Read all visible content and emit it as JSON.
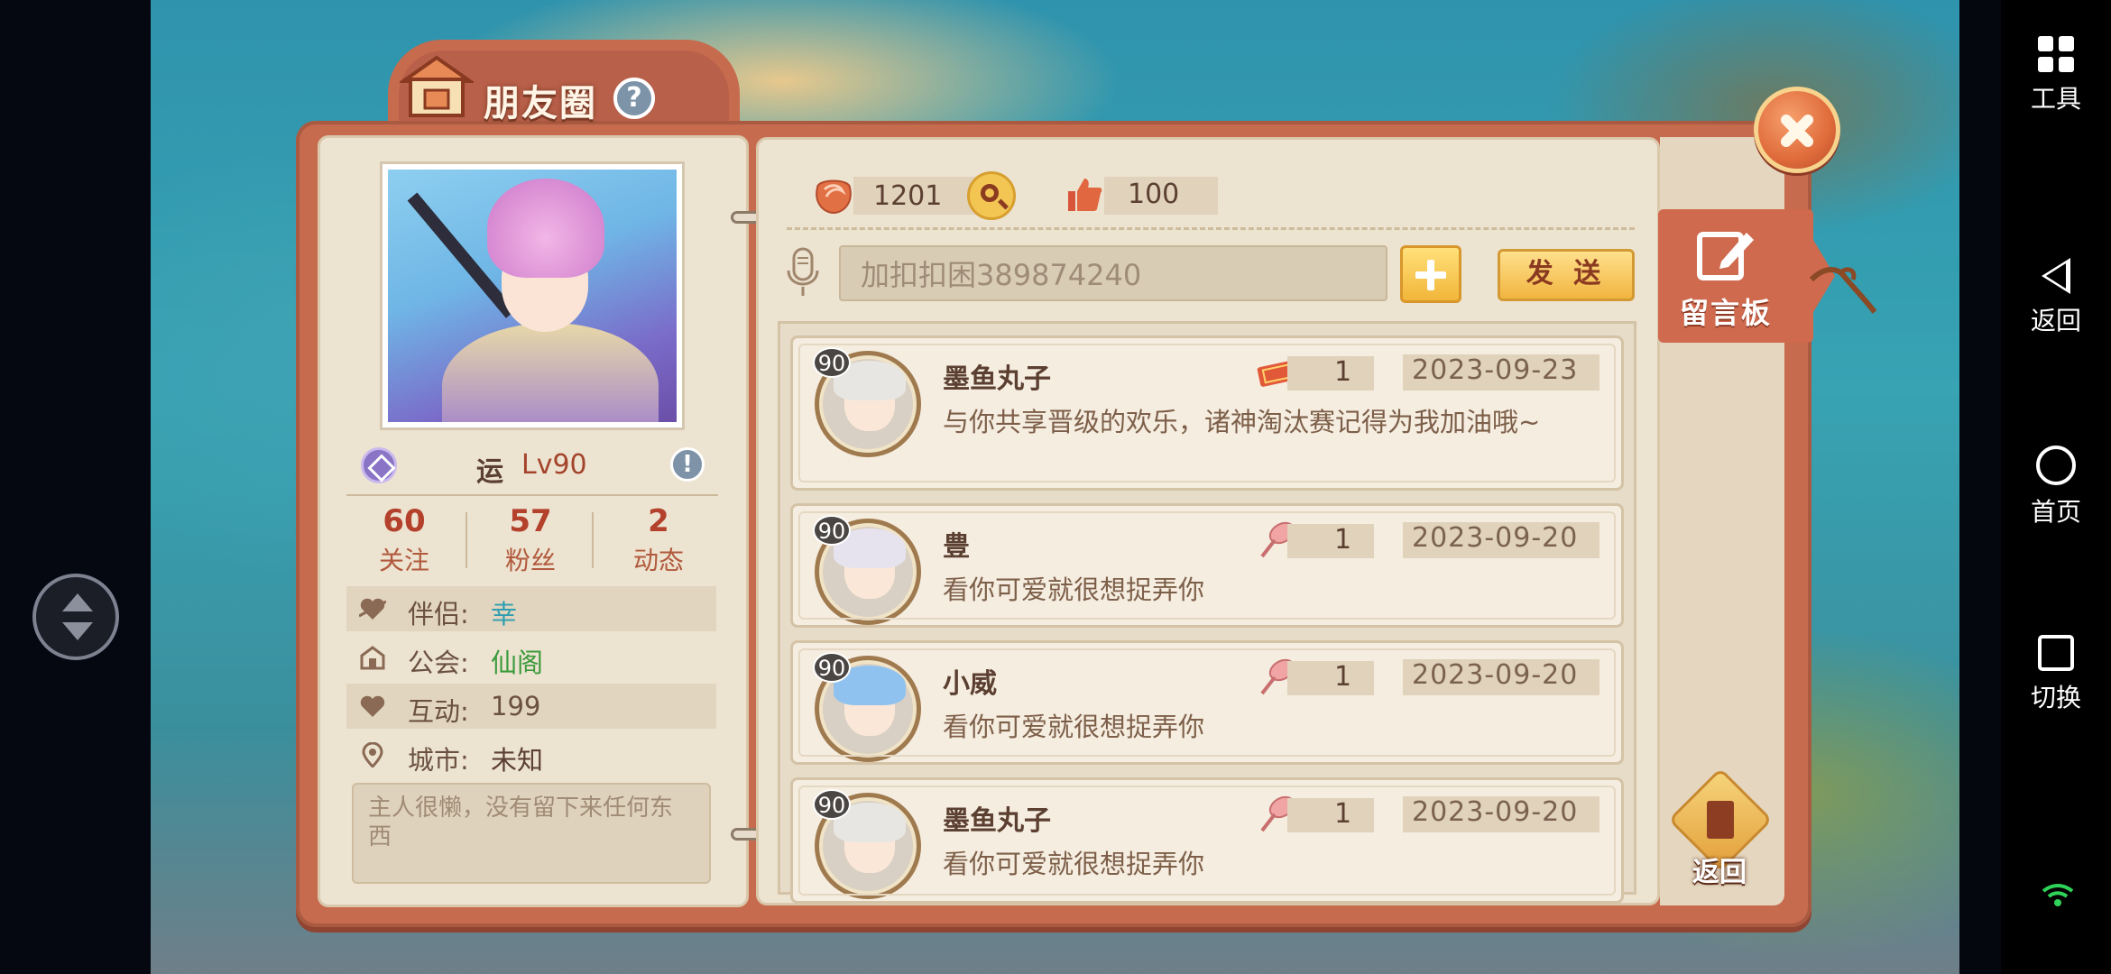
{
  "app": {
    "title": "朋友圈"
  },
  "profile": {
    "name": "运",
    "level": "Lv90",
    "stats": [
      {
        "value": "60",
        "label": "关注"
      },
      {
        "value": "57",
        "label": "粉丝"
      },
      {
        "value": "2",
        "label": "动态"
      }
    ],
    "info": [
      {
        "key": "伴侣:",
        "value": "幸",
        "value_color": "#2f9fb0",
        "icon": "heart-arrow-icon"
      },
      {
        "key": "公会:",
        "value": "仙阁",
        "value_color": "#3c9a3c",
        "icon": "guild-icon"
      },
      {
        "key": "互动:",
        "value": "199",
        "value_color": "#6b5140",
        "icon": "heart-icon"
      },
      {
        "key": "城市:",
        "value": "未知",
        "value_color": "#5b3f30",
        "icon": "location-pin-icon"
      }
    ],
    "bio": "主人很懒，没有留下来任何东西"
  },
  "counters": {
    "roses": "1201",
    "likes": "100"
  },
  "composer": {
    "value": "加扣扣困389874240",
    "send_label": "发 送"
  },
  "messages": [
    {
      "name": "墨鱼丸子",
      "level": "90",
      "text": "与你共享晋级的欢乐，诸神淘汰赛记得为我加油哦~",
      "gift_count": "1",
      "gift_icon": "ticket-icon",
      "date": "2023-09-23",
      "hair": "#e8e6e2"
    },
    {
      "name": "豊",
      "level": "90",
      "text": "看你可爱就很想捉弄你",
      "gift_count": "1",
      "gift_icon": "hammer-icon",
      "date": "2023-09-20",
      "hair": "#e7e3ee"
    },
    {
      "name": "小威",
      "level": "90",
      "text": "看你可爱就很想捉弄你",
      "gift_count": "1",
      "gift_icon": "hammer-icon",
      "date": "2023-09-20",
      "hair": "#8fc2ee"
    },
    {
      "name": "墨鱼丸子",
      "level": "90",
      "text": "看你可爱就很想捉弄你",
      "gift_count": "1",
      "gift_icon": "hammer-icon",
      "date": "2023-09-20",
      "hair": "#e8e6e2"
    }
  ],
  "side": {
    "board_label": "留言板",
    "back_label": "返回"
  },
  "navbar": {
    "items": [
      {
        "label": "工具",
        "icon": "grid-icon"
      },
      {
        "label": "返回",
        "icon": "back-triangle-icon"
      },
      {
        "label": "首页",
        "icon": "home-circle-icon"
      },
      {
        "label": "切换",
        "icon": "recents-square-icon"
      }
    ]
  },
  "colors": {
    "frame": "#c76b4f",
    "paper": "#ede3d1",
    "accent_red": "#b3412b",
    "button_yellow": "#f2b63a"
  }
}
